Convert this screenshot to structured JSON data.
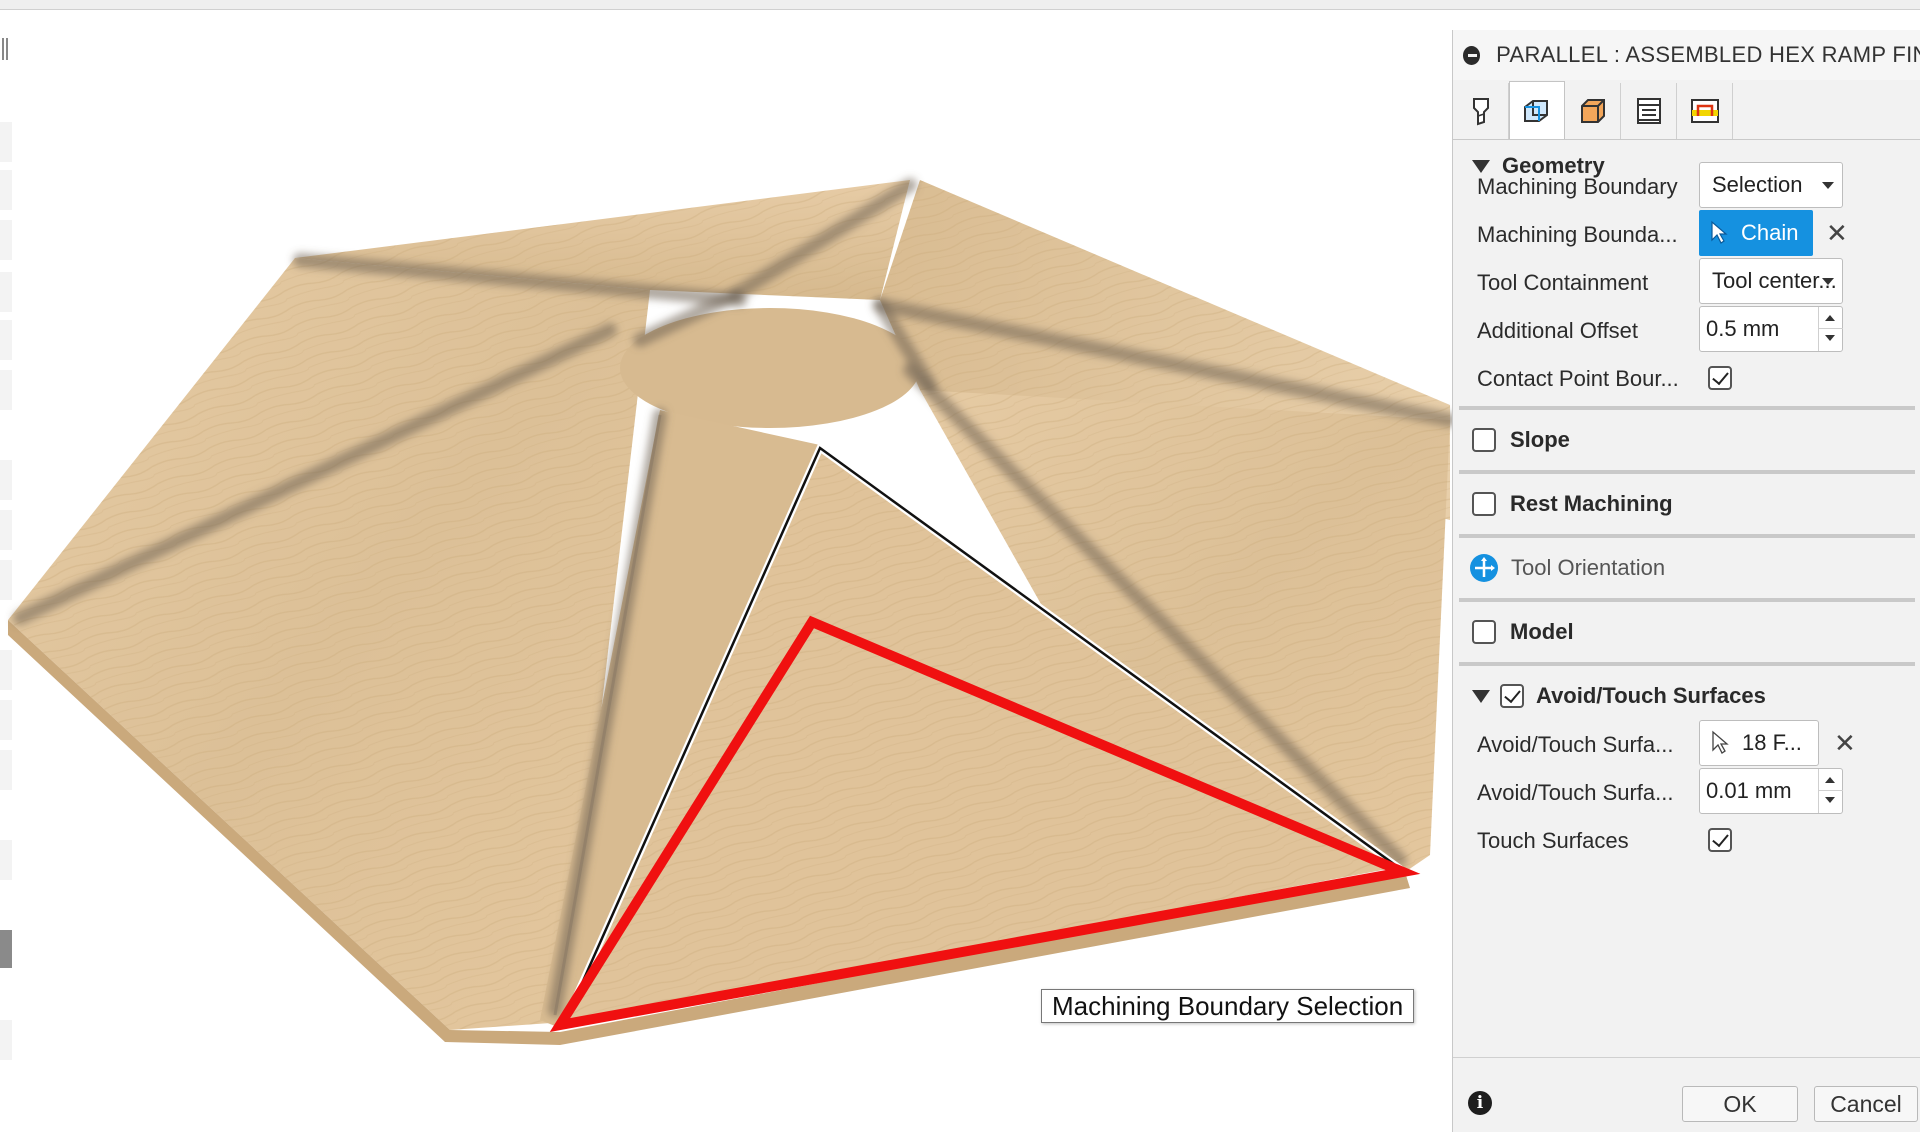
{
  "window": {
    "title": "PARALLEL : ASSEMBLED HEX RAMP FINISH"
  },
  "tabs": [
    {
      "icon": "tool-icon",
      "active": false
    },
    {
      "icon": "geometry-icon",
      "active": true
    },
    {
      "icon": "heights-icon",
      "active": false
    },
    {
      "icon": "passes-icon",
      "active": false
    },
    {
      "icon": "linking-icon",
      "active": false
    }
  ],
  "geometry": {
    "title": "Geometry",
    "machining_boundary": {
      "label": "Machining Boundary",
      "value": "Selection"
    },
    "machining_boundary_selection": {
      "label": "Machining Bounda...",
      "button": "Chain"
    },
    "tool_containment": {
      "label": "Tool Containment",
      "value": "Tool center..."
    },
    "additional_offset": {
      "label": "Additional Offset",
      "value": "0.5 mm"
    },
    "contact_point_boundary": {
      "label": "Contact Point Bour...",
      "checked": true
    }
  },
  "slope": {
    "title": "Slope",
    "checked": false
  },
  "rest_machining": {
    "title": "Rest Machining",
    "checked": false
  },
  "tool_orientation": {
    "title": "Tool Orientation"
  },
  "model": {
    "title": "Model",
    "checked": false
  },
  "avoid_touch": {
    "title": "Avoid/Touch Surfaces",
    "checked": true,
    "surfaces": {
      "label": "Avoid/Touch Surfa...",
      "value": "18 F..."
    },
    "offset": {
      "label": "Avoid/Touch Surfa...",
      "value": "0.01 mm"
    },
    "touch_surfaces": {
      "label": "Touch Surfaces",
      "checked": true
    }
  },
  "footer": {
    "ok": "OK",
    "cancel": "Cancel"
  },
  "viewport": {
    "tooltip": "Machining Boundary Selection"
  },
  "colors": {
    "accent": "#1591e0",
    "boundary": "#f01010",
    "wood": "#e2c59d"
  }
}
